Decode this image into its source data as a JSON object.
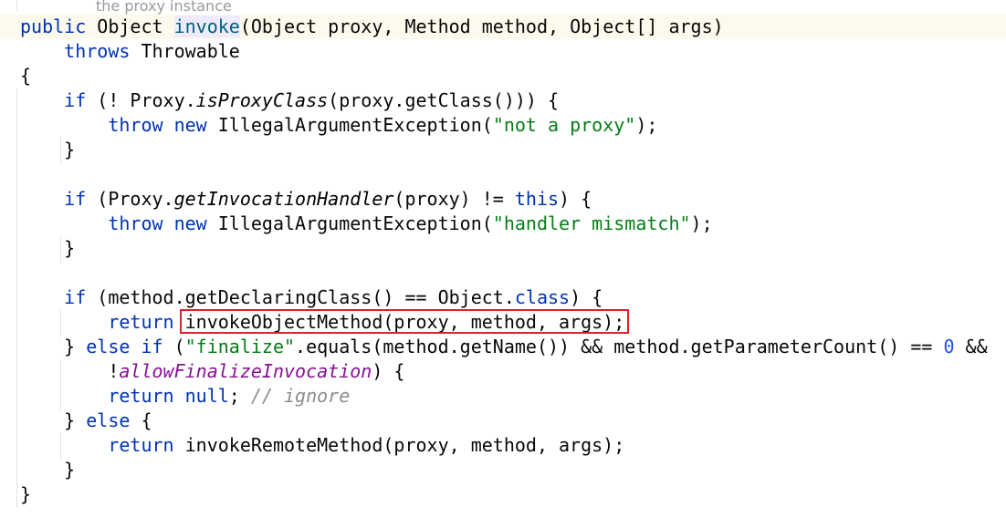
{
  "editor": {
    "doc_comment_fragment": "the proxy instance",
    "highlight_color": "#e0202a",
    "lines": [
      [
        [
          "kw",
          "public "
        ],
        [
          "plain",
          "Object "
        ],
        [
          "fn-decl",
          "invoke"
        ],
        [
          "plain",
          "(Object proxy, Method method, Object[] args)"
        ]
      ],
      [
        [
          "plain",
          "    "
        ],
        [
          "kw",
          "throws "
        ],
        [
          "plain",
          "Throwable"
        ]
      ],
      [
        [
          "plain",
          "{"
        ]
      ],
      [
        [
          "plain",
          "    "
        ],
        [
          "kw",
          "if "
        ],
        [
          "plain",
          "(! Proxy."
        ],
        [
          "ital",
          "isProxyClass"
        ],
        [
          "plain",
          "(proxy.getClass())) {"
        ]
      ],
      [
        [
          "plain",
          "        "
        ],
        [
          "kw",
          "throw new "
        ],
        [
          "plain",
          "IllegalArgumentException("
        ],
        [
          "str",
          "\"not a proxy\""
        ],
        [
          "plain",
          ");"
        ]
      ],
      [
        [
          "plain",
          "    }"
        ]
      ],
      [
        [
          "plain",
          ""
        ]
      ],
      [
        [
          "plain",
          "    "
        ],
        [
          "kw",
          "if "
        ],
        [
          "plain",
          "(Proxy."
        ],
        [
          "ital",
          "getInvocationHandler"
        ],
        [
          "plain",
          "(proxy) != "
        ],
        [
          "kw",
          "this"
        ],
        [
          "plain",
          ") {"
        ]
      ],
      [
        [
          "plain",
          "        "
        ],
        [
          "kw",
          "throw new "
        ],
        [
          "plain",
          "IllegalArgumentException("
        ],
        [
          "str",
          "\"handler mismatch\""
        ],
        [
          "plain",
          ");"
        ]
      ],
      [
        [
          "plain",
          "    }"
        ]
      ],
      [
        [
          "plain",
          ""
        ]
      ],
      [
        [
          "plain",
          "    "
        ],
        [
          "kw",
          "if "
        ],
        [
          "plain",
          "(method.getDeclaringClass() == Object."
        ],
        [
          "kw",
          "class"
        ],
        [
          "plain",
          ") {"
        ]
      ],
      [
        [
          "plain",
          "        "
        ],
        [
          "kw",
          "return "
        ],
        [
          "plain",
          "invokeObjectMethod(proxy, method, args);"
        ]
      ],
      [
        [
          "plain",
          "    } "
        ],
        [
          "kw",
          "else if "
        ],
        [
          "plain",
          "("
        ],
        [
          "str",
          "\"finalize\""
        ],
        [
          "plain",
          ".equals(method.getName()) && method.getParameterCount() == "
        ],
        [
          "num",
          "0"
        ],
        [
          "plain",
          " &&"
        ]
      ],
      [
        [
          "plain",
          "        !"
        ],
        [
          "field",
          "allowFinalizeInvocation"
        ],
        [
          "plain",
          ") {"
        ]
      ],
      [
        [
          "plain",
          "        "
        ],
        [
          "kw",
          "return null"
        ],
        [
          "plain",
          "; "
        ],
        [
          "cmt",
          "// ignore"
        ]
      ],
      [
        [
          "plain",
          "    } "
        ],
        [
          "kw",
          "else "
        ],
        [
          "plain",
          "{"
        ]
      ],
      [
        [
          "plain",
          "        "
        ],
        [
          "kw",
          "return "
        ],
        [
          "plain",
          "invokeRemoteMethod(proxy, method, args);"
        ]
      ],
      [
        [
          "plain",
          "    }"
        ]
      ],
      [
        [
          "plain",
          "}"
        ]
      ]
    ]
  }
}
